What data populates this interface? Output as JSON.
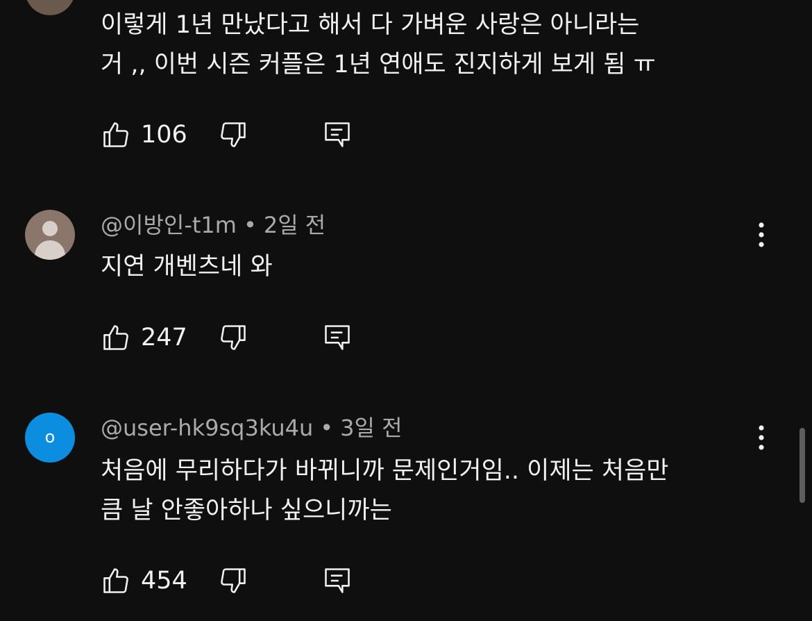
{
  "comments": [
    {
      "author": "",
      "time": "",
      "text_lines": [
        "이렇게 1년 만났다고 해서 다 가벼운 사랑은 아니라는",
        "거 ,, 이번 시즌 커플은 1년 연애도 진지하게 보게 됨 ㅠ"
      ],
      "likes": "106"
    },
    {
      "author": "@이방인-t1m",
      "separator": "•",
      "time": "2일 전",
      "text_lines": [
        "지연 개벤츠네 와"
      ],
      "likes": "247"
    },
    {
      "author": "@user-hk9sq3ku4u",
      "separator": "•",
      "time": "3일 전",
      "avatar_letter": "o",
      "text_lines": [
        "처음에 무리하다가 바뀌니까 문제인거임.. 이제는 처음만",
        "큼 날 안좋아하나 싶으니까는"
      ],
      "likes": "454"
    }
  ],
  "colors": {
    "background": "#0f0f0f",
    "text": "#f1f1f1",
    "meta": "#aaaaaa",
    "avatar_blue": "#0b8ee0"
  },
  "icons": [
    "thumbs-up-icon",
    "thumbs-down-icon",
    "reply-icon",
    "more-vert-icon"
  ]
}
